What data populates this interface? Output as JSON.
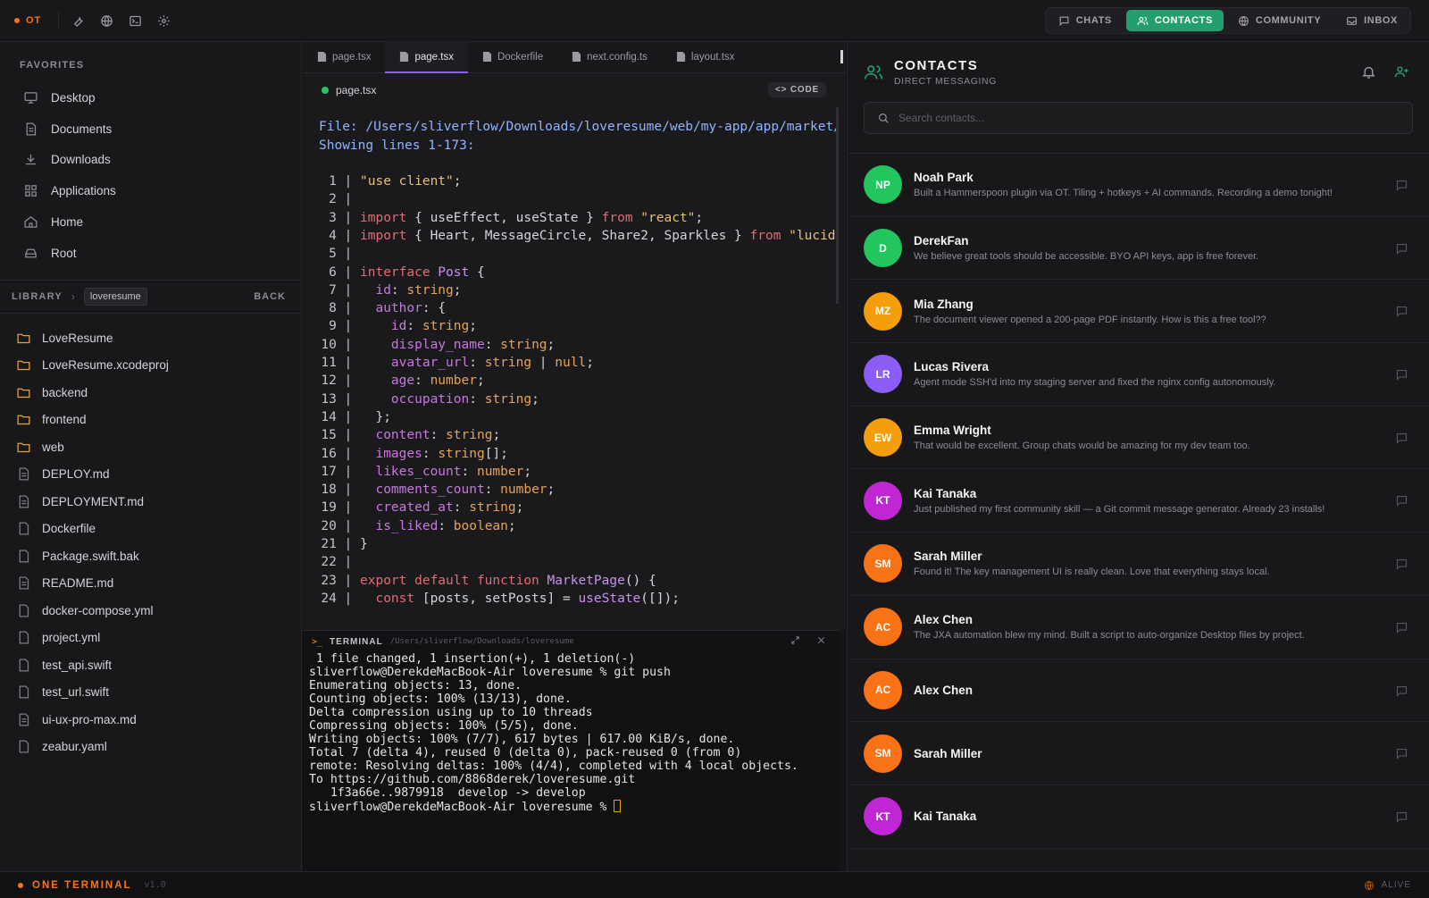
{
  "app": {
    "brand": "OT",
    "status_brand": "ONE TERMINAL",
    "version": "v1.0",
    "status_right": "ALIVE"
  },
  "nav_tabs": [
    {
      "label": "CHATS",
      "icon": "chat-icon"
    },
    {
      "label": "CONTACTS",
      "icon": "users-icon",
      "active": true
    },
    {
      "label": "COMMUNITY",
      "icon": "globe-icon"
    },
    {
      "label": "INBOX",
      "icon": "inbox-icon"
    }
  ],
  "sidebar": {
    "favorites_title": "FAVORITES",
    "favorites": [
      {
        "label": "Desktop",
        "icon": "monitor-icon"
      },
      {
        "label": "Documents",
        "icon": "document-icon"
      },
      {
        "label": "Downloads",
        "icon": "download-icon"
      },
      {
        "label": "Applications",
        "icon": "grid-icon"
      },
      {
        "label": "Home",
        "icon": "home-icon"
      },
      {
        "label": "Root",
        "icon": "drive-icon"
      }
    ],
    "library_label": "LIBRARY",
    "library_crumb": "loveresume",
    "back_label": "BACK",
    "files": [
      {
        "name": "LoveResume",
        "type": "folder"
      },
      {
        "name": "LoveResume.xcodeproj",
        "type": "folder"
      },
      {
        "name": "backend",
        "type": "folder"
      },
      {
        "name": "frontend",
        "type": "folder"
      },
      {
        "name": "web",
        "type": "folder"
      },
      {
        "name": "DEPLOY.md",
        "type": "doc"
      },
      {
        "name": "DEPLOYMENT.md",
        "type": "doc"
      },
      {
        "name": "Dockerfile",
        "type": "file"
      },
      {
        "name": "Package.swift.bak",
        "type": "file"
      },
      {
        "name": "README.md",
        "type": "doc"
      },
      {
        "name": "docker-compose.yml",
        "type": "file"
      },
      {
        "name": "project.yml",
        "type": "file"
      },
      {
        "name": "test_api.swift",
        "type": "file"
      },
      {
        "name": "test_url.swift",
        "type": "file"
      },
      {
        "name": "ui-ux-pro-max.md",
        "type": "doc"
      },
      {
        "name": "zeabur.yaml",
        "type": "file"
      }
    ]
  },
  "editor": {
    "tabs": [
      "page.tsx",
      "page.tsx",
      "Dockerfile",
      "next.config.ts",
      "layout.tsx"
    ],
    "active_tab": 1,
    "current_file": "page.tsx",
    "code_button": "<> CODE",
    "file_prefix": "File: ",
    "file_path": "/Users/sliverflow/Downloads/loveresume/web/my-app/app/market/p",
    "showing_text": "Showing lines 1-173:",
    "lines": [
      [
        [
          "str",
          "\"use client\""
        ],
        [
          "plain",
          ";"
        ]
      ],
      [],
      [
        [
          "kw",
          "import"
        ],
        [
          "plain",
          " { useEffect, useState } "
        ],
        [
          "kw",
          "from"
        ],
        [
          "str",
          " \"react\""
        ],
        [
          "plain",
          ";"
        ]
      ],
      [
        [
          "kw",
          "import"
        ],
        [
          "plain",
          " { Heart, MessageCircle, Share2, Sparkles } "
        ],
        [
          "kw",
          "from"
        ],
        [
          "str",
          " \"lucid"
        ]
      ],
      [],
      [
        [
          "kw",
          "interface"
        ],
        [
          "fn",
          " Post"
        ],
        [
          "plain",
          " {"
        ]
      ],
      [
        [
          "prop",
          "  id"
        ],
        [
          "plain",
          ": "
        ],
        [
          "typ",
          "string"
        ],
        [
          "plain",
          ";"
        ]
      ],
      [
        [
          "prop",
          "  author"
        ],
        [
          "plain",
          ": {"
        ]
      ],
      [
        [
          "prop",
          "    id"
        ],
        [
          "plain",
          ": "
        ],
        [
          "typ",
          "string"
        ],
        [
          "plain",
          ";"
        ]
      ],
      [
        [
          "prop",
          "    display_name"
        ],
        [
          "plain",
          ": "
        ],
        [
          "typ",
          "string"
        ],
        [
          "plain",
          ";"
        ]
      ],
      [
        [
          "prop",
          "    avatar_url"
        ],
        [
          "plain",
          ": "
        ],
        [
          "typ",
          "string"
        ],
        [
          "plain",
          " | "
        ],
        [
          "typ",
          "null"
        ],
        [
          "plain",
          ";"
        ]
      ],
      [
        [
          "prop",
          "    age"
        ],
        [
          "plain",
          ": "
        ],
        [
          "typ",
          "number"
        ],
        [
          "plain",
          ";"
        ]
      ],
      [
        [
          "prop",
          "    occupation"
        ],
        [
          "plain",
          ": "
        ],
        [
          "typ",
          "string"
        ],
        [
          "plain",
          ";"
        ]
      ],
      [
        [
          "plain",
          "  };"
        ]
      ],
      [
        [
          "prop",
          "  content"
        ],
        [
          "plain",
          ": "
        ],
        [
          "typ",
          "string"
        ],
        [
          "plain",
          ";"
        ]
      ],
      [
        [
          "prop",
          "  images"
        ],
        [
          "plain",
          ": "
        ],
        [
          "typ",
          "string"
        ],
        [
          "plain",
          "[];"
        ]
      ],
      [
        [
          "prop",
          "  likes_count"
        ],
        [
          "plain",
          ": "
        ],
        [
          "typ",
          "number"
        ],
        [
          "plain",
          ";"
        ]
      ],
      [
        [
          "prop",
          "  comments_count"
        ],
        [
          "plain",
          ": "
        ],
        [
          "typ",
          "number"
        ],
        [
          "plain",
          ";"
        ]
      ],
      [
        [
          "prop",
          "  created_at"
        ],
        [
          "plain",
          ": "
        ],
        [
          "typ",
          "string"
        ],
        [
          "plain",
          ";"
        ]
      ],
      [
        [
          "prop",
          "  is_liked"
        ],
        [
          "plain",
          ": "
        ],
        [
          "typ",
          "boolean"
        ],
        [
          "plain",
          ";"
        ]
      ],
      [
        [
          "plain",
          "}"
        ]
      ],
      [],
      [
        [
          "kw",
          "export default function"
        ],
        [
          "fn",
          " MarketPage"
        ],
        [
          "plain",
          "() {"
        ]
      ],
      [
        [
          "kw",
          "  const"
        ],
        [
          "plain",
          " [posts, setPosts] = "
        ],
        [
          "fn",
          "useState"
        ],
        [
          "plain",
          "([]);"
        ]
      ]
    ]
  },
  "terminal": {
    "title": "TERMINAL",
    "path": "/Users/sliverflow/Downloads/loveresume",
    "lines": [
      " 1 file changed, 1 insertion(+), 1 deletion(-)",
      "sliverflow@DerekdeMacBook-Air loveresume % git push",
      "Enumerating objects: 13, done.",
      "Counting objects: 100% (13/13), done.",
      "Delta compression using up to 10 threads",
      "Compressing objects: 100% (5/5), done.",
      "Writing objects: 100% (7/7), 617 bytes | 617.00 KiB/s, done.",
      "Total 7 (delta 4), reused 0 (delta 0), pack-reused 0 (from 0)",
      "remote: Resolving deltas: 100% (4/4), completed with 4 local objects.",
      "To https://github.com/8868derek/loveresume.git",
      "   1f3a66e..9879918  develop -> develop"
    ],
    "prompt": "sliverflow@DerekdeMacBook-Air loveresume % "
  },
  "contacts": {
    "title": "CONTACTS",
    "subtitle": "DIRECT MESSAGING",
    "search_placeholder": "Search contacts...",
    "list": [
      {
        "initials": "NP",
        "name": "Noah Park",
        "message": "Built a Hammerspoon plugin via OT. Tiling + hotkeys + AI commands. Recording a demo tonight!",
        "color": "#22c55e"
      },
      {
        "initials": "D",
        "name": "DerekFan",
        "message": "We believe great tools should be accessible. BYO API keys, app is free forever.",
        "color": "#22c55e"
      },
      {
        "initials": "MZ",
        "name": "Mia Zhang",
        "message": "The document viewer opened a 200-page PDF instantly. How is this a free tool??",
        "color": "#f59e0b"
      },
      {
        "initials": "LR",
        "name": "Lucas Rivera",
        "message": "Agent mode SSH'd into my staging server and fixed the nginx config autonomously.",
        "color": "#8b5cf6"
      },
      {
        "initials": "EW",
        "name": "Emma Wright",
        "message": "That would be excellent. Group chats would be amazing for my dev team too.",
        "color": "#f59e0b"
      },
      {
        "initials": "KT",
        "name": "Kai Tanaka",
        "message": "Just published my first community skill — a Git commit message generator. Already 23 installs!",
        "color": "#c026d3"
      },
      {
        "initials": "SM",
        "name": "Sarah Miller",
        "message": "Found it! The key management UI is really clean. Love that everything stays local.",
        "color": "#f97316"
      },
      {
        "initials": "AC",
        "name": "Alex Chen",
        "message": "The JXA automation blew my mind. Built a script to auto-organize Desktop files by project.",
        "color": "#f97316"
      },
      {
        "initials": "AC",
        "name": "Alex Chen",
        "message": "",
        "color": "#f97316"
      },
      {
        "initials": "SM",
        "name": "Sarah Miller",
        "message": "",
        "color": "#f97316"
      },
      {
        "initials": "KT",
        "name": "Kai Tanaka",
        "message": "",
        "color": "#c026d3"
      }
    ]
  }
}
